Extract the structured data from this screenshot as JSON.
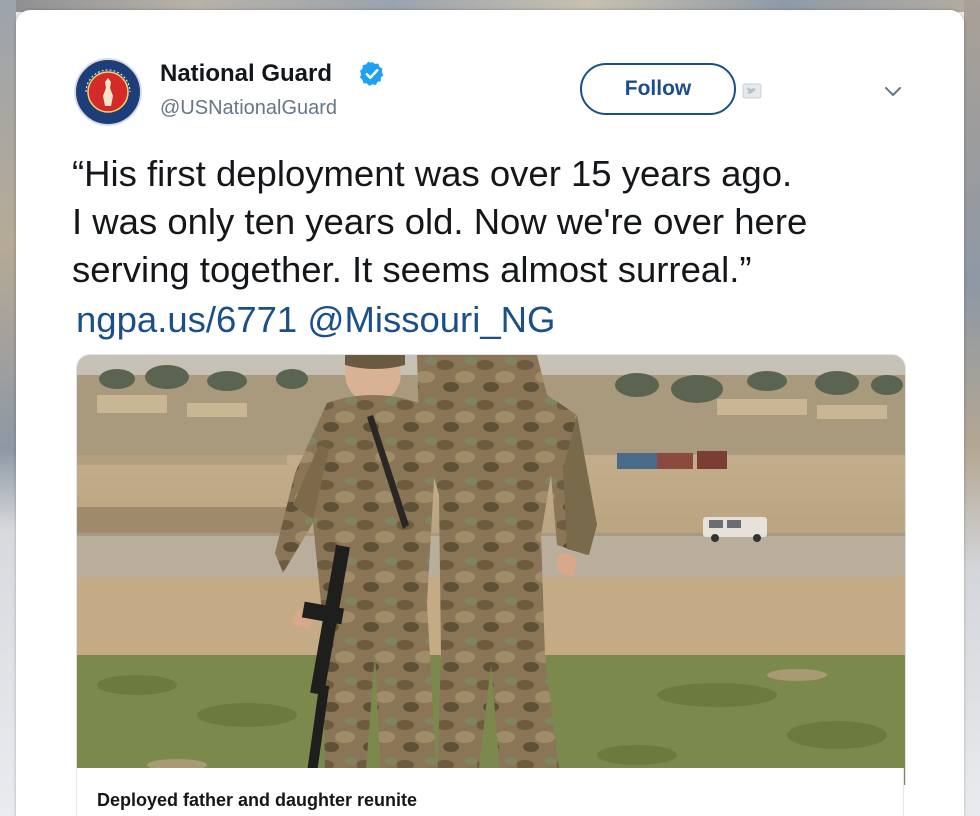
{
  "tweet": {
    "author": {
      "name": "National Guard",
      "handle": "@USNationalGuard",
      "verified": true,
      "avatar_icon": "national-guard-seal-icon"
    },
    "follow_label": "Follow",
    "text_lines": [
      "“His first deployment was over 15 years ago.",
      "I was only ten years old. Now we're over here",
      "serving together. It seems almost surreal.”"
    ],
    "link": "ngpa.us/6771",
    "mention": "@Missouri_NG",
    "card": {
      "title": "Deployed father and daughter reunite"
    }
  },
  "colors": {
    "link": "#1b4f8a",
    "verified": "#1da1f2",
    "text": "#14171a",
    "secondary": "#657786"
  }
}
